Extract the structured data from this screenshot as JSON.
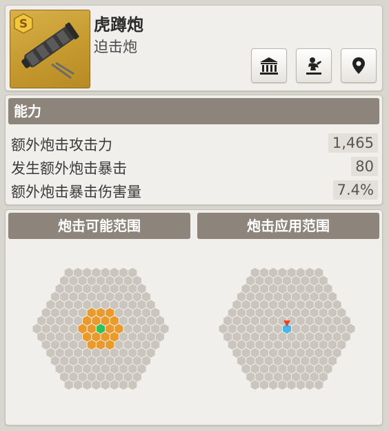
{
  "item": {
    "name": "虎蹲炮",
    "type": "迫击炮",
    "grade": "S"
  },
  "buttons": [
    {
      "icon": "museum-icon"
    },
    {
      "icon": "wrestler-icon"
    },
    {
      "icon": "map-pin-icon"
    }
  ],
  "abilities": {
    "header": "能力",
    "stats": [
      {
        "label": "额外炮击攻击力",
        "value": "1,465"
      },
      {
        "label": "发生额外炮击暴击",
        "value": "80"
      },
      {
        "label": "额外炮击暴击伤害量",
        "value": "7.4%"
      }
    ]
  },
  "range": {
    "possible_title": "炮击可能范围",
    "apply_title": "炮击应用范围",
    "colors": {
      "cell": "#cbc6bd",
      "range": "#ea9a2a",
      "center": "#2ec25a",
      "apply_center": "#46b7e6",
      "marker": "#e8422c"
    },
    "possible_range_radius": 2,
    "apply_range_radius": 0,
    "grid_radius": 7
  }
}
